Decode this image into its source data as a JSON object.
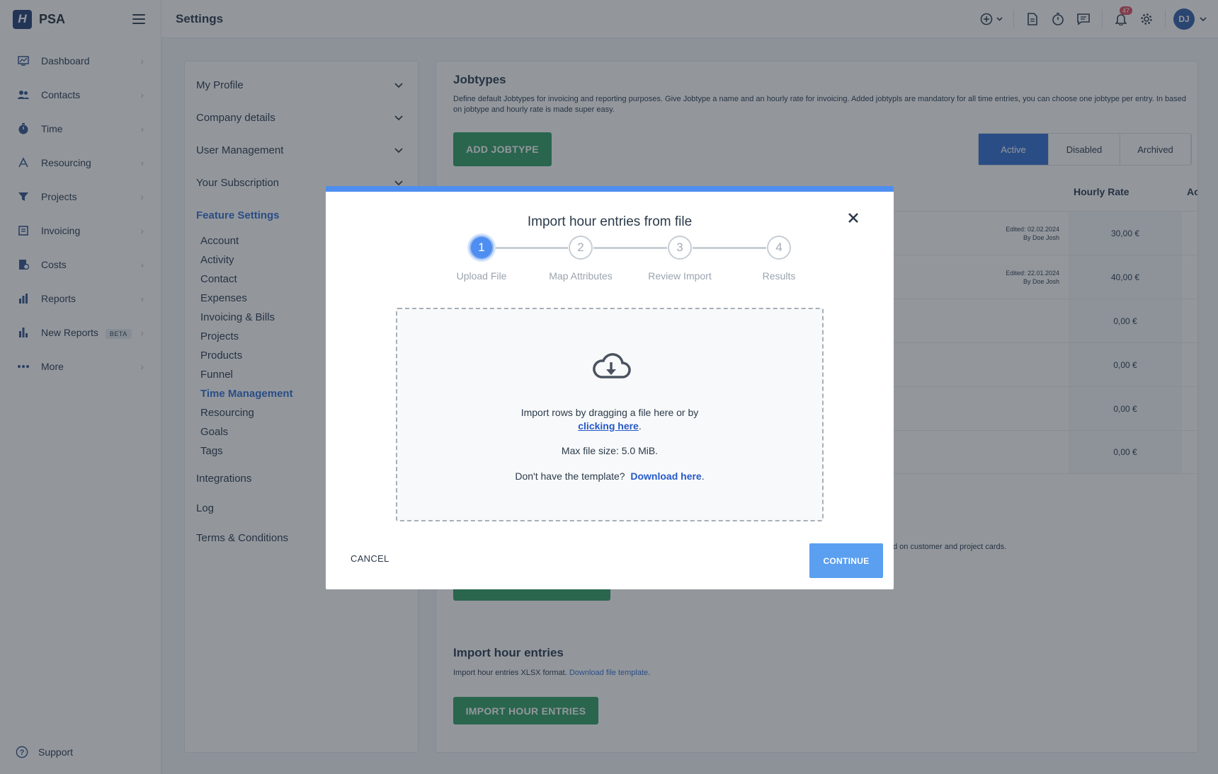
{
  "app": {
    "logo_letter": "H",
    "name": "PSA"
  },
  "sidebar": {
    "items": [
      {
        "label": "Dashboard",
        "icon": "dashboard-icon"
      },
      {
        "label": "Contacts",
        "icon": "contacts-icon"
      },
      {
        "label": "Time",
        "icon": "stopwatch-icon"
      },
      {
        "label": "Resourcing",
        "icon": "resourcing-icon"
      },
      {
        "label": "Projects",
        "icon": "funnel-icon"
      },
      {
        "label": "Invoicing",
        "icon": "invoice-icon"
      },
      {
        "label": "Costs",
        "icon": "costs-icon"
      },
      {
        "label": "Reports",
        "icon": "bar-chart-icon"
      },
      {
        "label": "New Reports",
        "icon": "bar-chart-icon",
        "badge": "BETA"
      },
      {
        "label": "More",
        "icon": "more-dots-icon"
      }
    ],
    "support": "Support"
  },
  "topbar": {
    "title": "Settings",
    "notification_count": "47",
    "avatar_initials": "DJ"
  },
  "settings_nav": {
    "accordions": [
      "My Profile",
      "Company details",
      "User Management",
      "Your Subscription"
    ],
    "feature_title": "Feature Settings",
    "feature_items": [
      "Account",
      "Activity",
      "Contact",
      "Expenses",
      "Invoicing & Bills",
      "Projects",
      "Products",
      "Funnel",
      "Time Management",
      "Resourcing",
      "Goals",
      "Tags"
    ],
    "active_feature": "Time Management",
    "bottom_items": [
      "Integrations",
      "Log",
      "Terms & Conditions"
    ]
  },
  "jobtypes": {
    "title": "Jobtypes",
    "description": "Define default Jobtypes for invoicing and reporting purposes. Give Jobtype a name and an hourly rate for invoicing. Added jobtypls are mandatory for all time entries, you can choose one jobtype per entry. In based on jobtype and hourly rate is made super easy.",
    "add_button": "ADD JOBTYPE",
    "tabs": [
      "Active",
      "Disabled",
      "Archived"
    ],
    "columns": {
      "hourly_rate": "Hourly Rate",
      "last": "Ac"
    },
    "rows": [
      {
        "edited": "Edited: 02.02.2024",
        "by": "By Doe Josh",
        "rate": "30,00 €"
      },
      {
        "edited": "Edited: 22.01.2024",
        "by": "By Doe Josh",
        "rate": "40,00 €"
      },
      {
        "edited": "",
        "by": "",
        "rate": "0,00 €"
      },
      {
        "edited": "",
        "by": "",
        "rate": "0,00 €"
      },
      {
        "edited": "",
        "by": "",
        "rate": "0,00 €"
      },
      {
        "edited": "",
        "by": "",
        "rate": "0,00 €"
      }
    ],
    "partial_text": "d on customer and project cards."
  },
  "import_section": {
    "title": "Import hour entries",
    "desc": "Import hour entries XLSX format.",
    "link": "Download file template",
    "button": "IMPORT HOUR ENTRIES"
  },
  "modal": {
    "title": "Import hour entries from file",
    "steps": [
      {
        "num": "1",
        "label": "Upload File"
      },
      {
        "num": "2",
        "label": "Map Attributes"
      },
      {
        "num": "3",
        "label": "Review Import"
      },
      {
        "num": "4",
        "label": "Results"
      }
    ],
    "dropzone": {
      "line1": "Import rows by dragging a file here or by",
      "link": "clicking here",
      "max_size": "Max file size: 5.0 MiB.",
      "template_q": "Don't have the template?",
      "template_link": "Download here"
    },
    "cancel": "CANCEL",
    "continue": "CONTINUE"
  },
  "colors": {
    "accent": "#2e6bd0",
    "green": "#2d9a63",
    "modal_bar": "#4e8ef0"
  }
}
